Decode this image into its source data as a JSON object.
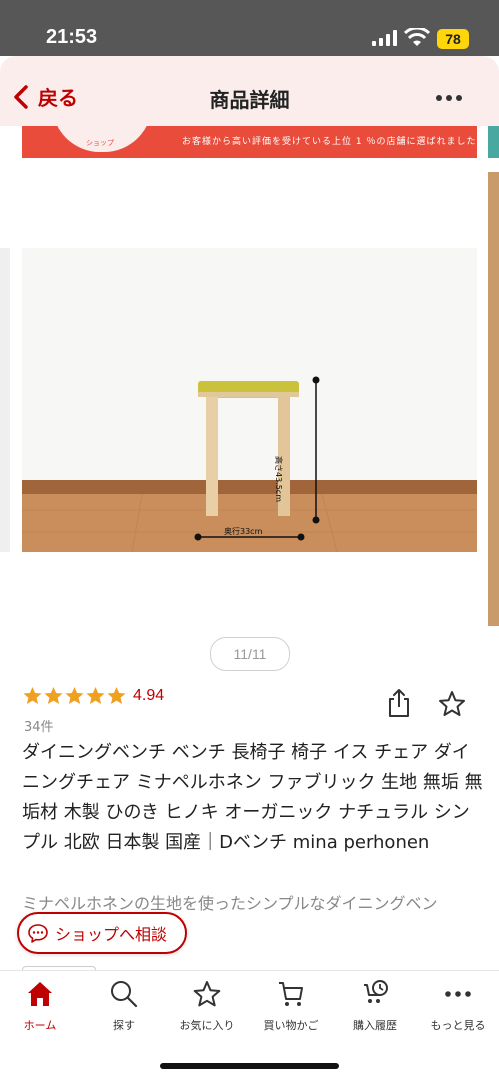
{
  "status_bar": {
    "time": "21:53",
    "battery": "78"
  },
  "header": {
    "back_label": "戻る",
    "title": "商品詳細"
  },
  "banner": {
    "badge_text": "ショップ",
    "text": "お客様から高い評価を受けている上位 1 ％の店舗に選ばれました"
  },
  "image": {
    "height_label": "高さ43.5cm",
    "depth_label": "奥行33cm",
    "counter": "11/11"
  },
  "rating": {
    "value": "4.94",
    "stars": 5,
    "review_count": "34件"
  },
  "product": {
    "title": "ダイニングベンチ ベンチ 長椅子 椅子 イス チェア ダイニングチェア ミナペルホネン ファブリック 生地 無垢 無垢材 木製 ひのき ヒノキ オーガニック ナチュラル シンプル 北欧 日本製 国産｜Dベンチ mina perhonen",
    "description": "ミナペルホネンの生地を使ったシンプルなダイニングベン"
  },
  "consult_button": "ショップへ相談",
  "tabbar": {
    "items": [
      {
        "label": "ホーム",
        "icon": "home-icon",
        "active": true
      },
      {
        "label": "探す",
        "icon": "search-icon",
        "active": false
      },
      {
        "label": "お気に入り",
        "icon": "star-icon",
        "active": false
      },
      {
        "label": "買い物かご",
        "icon": "cart-icon",
        "active": false
      },
      {
        "label": "購入履歴",
        "icon": "history-icon",
        "active": false
      },
      {
        "label": "もっと見る",
        "icon": "more-icon",
        "active": false
      }
    ]
  },
  "colors": {
    "accent": "#bf0000",
    "star": "#f0a020",
    "banner": "#ea4c3b",
    "header_bg": "#fceded"
  }
}
